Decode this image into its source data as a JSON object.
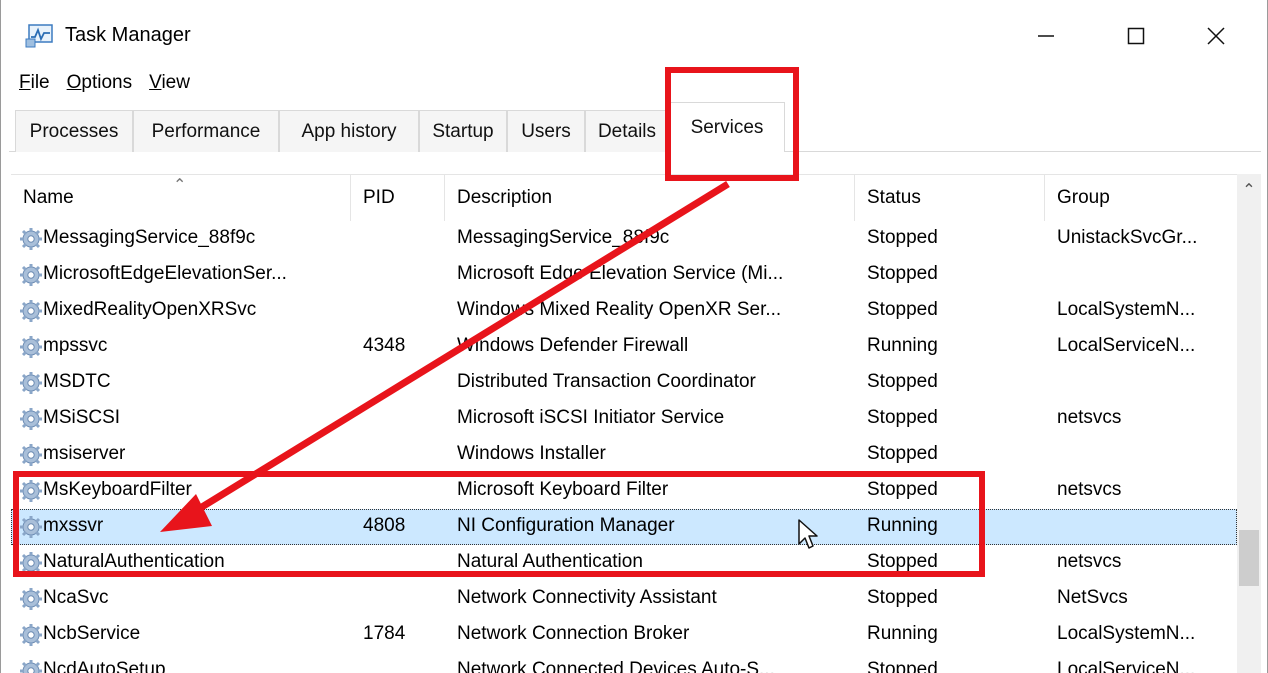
{
  "window": {
    "title": "Task Manager",
    "controls": {
      "minimize": "—",
      "maximize": "☐",
      "close": "✕"
    }
  },
  "menu": [
    {
      "hot": "F",
      "rest": "ile"
    },
    {
      "hot": "O",
      "rest": "ptions"
    },
    {
      "hot": "V",
      "rest": "iew"
    }
  ],
  "tabs": [
    "Processes",
    "Performance",
    "App history",
    "Startup",
    "Users",
    "Details",
    "Services"
  ],
  "active_tab": "Services",
  "columns": [
    "Name",
    "PID",
    "Description",
    "Status",
    "Group"
  ],
  "rows": [
    {
      "name": "MessagingService_88f9c",
      "pid": "",
      "description": "MessagingService_88f9c",
      "status": "Stopped",
      "group": "UnistackSvcGr..."
    },
    {
      "name": "MicrosoftEdgeElevationSer...",
      "pid": "",
      "description": "Microsoft Edge Elevation Service (Mi...",
      "status": "Stopped",
      "group": ""
    },
    {
      "name": "MixedRealityOpenXRSvc",
      "pid": "",
      "description": "Windows Mixed Reality OpenXR Ser...",
      "status": "Stopped",
      "group": "LocalSystemN..."
    },
    {
      "name": "mpssvc",
      "pid": "4348",
      "description": "Windows Defender Firewall",
      "status": "Running",
      "group": "LocalServiceN..."
    },
    {
      "name": "MSDTC",
      "pid": "",
      "description": "Distributed Transaction Coordinator",
      "status": "Stopped",
      "group": ""
    },
    {
      "name": "MSiSCSI",
      "pid": "",
      "description": "Microsoft iSCSI Initiator Service",
      "status": "Stopped",
      "group": "netsvcs"
    },
    {
      "name": "msiserver",
      "pid": "",
      "description": "Windows Installer",
      "status": "Stopped",
      "group": ""
    },
    {
      "name": "MsKeyboardFilter",
      "pid": "",
      "description": "Microsoft Keyboard Filter",
      "status": "Stopped",
      "group": "netsvcs"
    },
    {
      "name": "mxssvr",
      "pid": "4808",
      "description": "NI Configuration Manager",
      "status": "Running",
      "group": "",
      "selected": true
    },
    {
      "name": "NaturalAuthentication",
      "pid": "",
      "description": "Natural Authentication",
      "status": "Stopped",
      "group": "netsvcs"
    },
    {
      "name": "NcaSvc",
      "pid": "",
      "description": "Network Connectivity Assistant",
      "status": "Stopped",
      "group": "NetSvcs"
    },
    {
      "name": "NcbService",
      "pid": "1784",
      "description": "Network Connection Broker",
      "status": "Running",
      "group": "LocalSystemN..."
    },
    {
      "name": "NcdAutoSetup",
      "pid": "",
      "description": "Network Connected Devices Auto-S...",
      "status": "Stopped",
      "group": "LocalServiceN..."
    }
  ],
  "colors": {
    "annotation": "#e8141b",
    "selection": "#cce8ff",
    "gear": "#7f9fc4"
  },
  "icons": [
    "task-manager-icon",
    "gear-icon",
    "mouse-cursor-icon"
  ]
}
